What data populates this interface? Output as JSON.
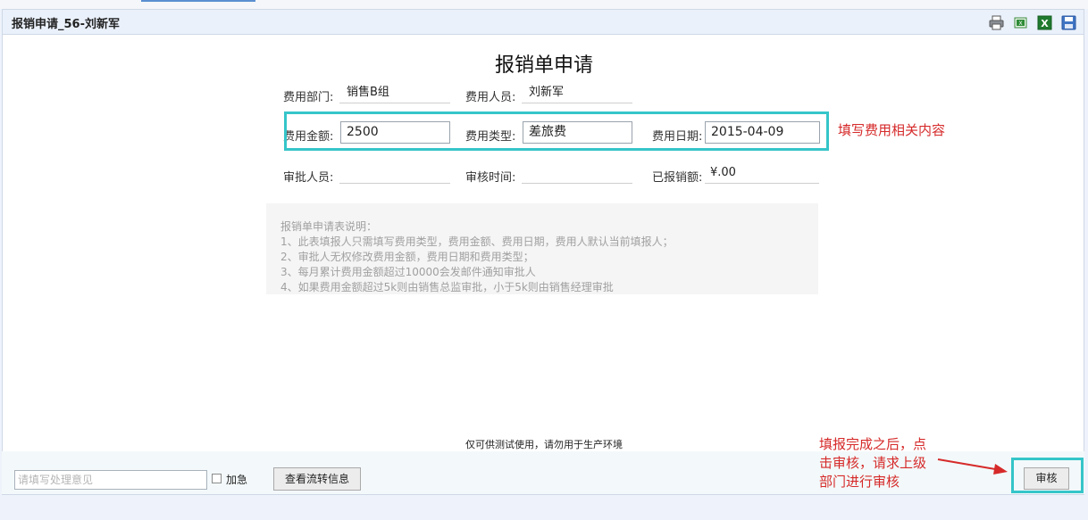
{
  "window": {
    "title": "报销申请_56-刘新军"
  },
  "toolbar": {
    "icons": [
      "print-icon",
      "export-excel-icon",
      "excel-icon",
      "save-icon"
    ]
  },
  "form": {
    "title": "报销单申请",
    "department": {
      "label": "费用部门:",
      "value": "销售B组"
    },
    "person": {
      "label": "费用人员:",
      "value": "刘新军"
    },
    "amount": {
      "label": "费用金额:",
      "value": "2500"
    },
    "type": {
      "label": "费用类型:",
      "value": "差旅费"
    },
    "date": {
      "label": "费用日期:",
      "value": "2015-04-09"
    },
    "approver": {
      "label": "审批人员:",
      "value": ""
    },
    "review_time": {
      "label": "审核时间:",
      "value": ""
    },
    "reimbursed": {
      "label": "已报销额:",
      "value": "¥.00"
    }
  },
  "notes": {
    "heading": "报销单申请表说明：",
    "items": [
      "1、此表填报人只需填写费用类型，费用金额、费用日期，费用人默认当前填报人；",
      "2、审批人无权修改费用金额，费用日期和费用类型；",
      "3、每月累计费用金额超过10000会发邮件通知审批人",
      "4、如果费用金额超过5k则由销售总监审批，小于5k则由销售经理审批"
    ]
  },
  "annotations": {
    "fill_hint": "填写费用相关内容",
    "submit_hint": [
      "填报完成之后，点",
      "击审核，请求上级",
      "部门进行审核"
    ]
  },
  "footer": {
    "disclaimer": "仅可供测试使用，请勿用于生产环境",
    "opinion_placeholder": "请填写处理意见",
    "urgent_label": "加急",
    "flow_button": "查看流转信息",
    "review_button": "审核"
  },
  "colors": {
    "highlight": "#35c5c9",
    "annotation": "#d62a2a"
  }
}
